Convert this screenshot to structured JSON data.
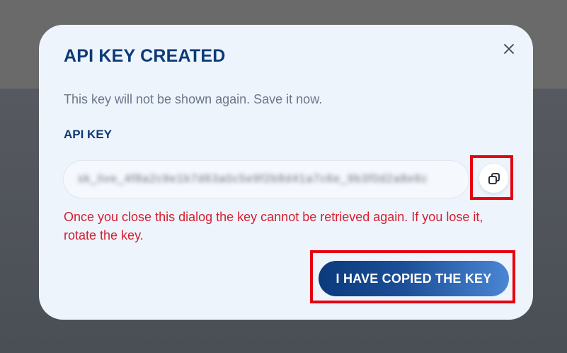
{
  "dialog": {
    "title": "API KEY CREATED",
    "subtitle": "This key will not be shown again. Save it now.",
    "field_label": "API KEY",
    "api_key_value": "sk_live_4f8a2c9e1b7d63a0c5e9f2b8d41a7c6e_9b3f0d2a8e6c",
    "warning": "Once you close this dialog the key cannot be retrieved again. If you lose it, rotate the key.",
    "confirm_label": "I HAVE COPIED THE KEY",
    "close_icon": "close-icon",
    "copy_icon": "copy-icon"
  },
  "colors": {
    "title": "#0d3a78",
    "warning": "#d41e2e",
    "button_start": "#0b3a7c",
    "button_end": "#4a86d4",
    "highlight": "#e60012",
    "modal_bg": "#eef4fc"
  }
}
